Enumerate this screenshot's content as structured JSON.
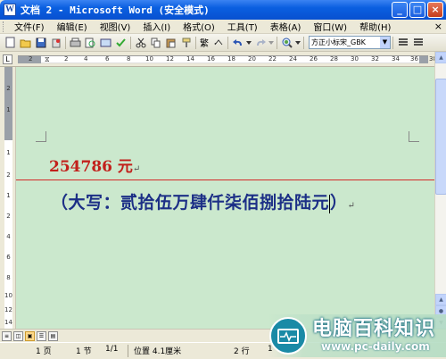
{
  "window": {
    "icon_letter": "W",
    "title": "文档 2 - Microsoft Word (安全模式)",
    "minimize": "_",
    "maximize": "□",
    "close": "×"
  },
  "menu": {
    "items": [
      "文件(F)",
      "编辑(E)",
      "视图(V)",
      "插入(I)",
      "格式(O)",
      "工具(T)",
      "表格(A)",
      "窗口(W)",
      "帮助(H)"
    ],
    "close_doc": "×"
  },
  "toolbar": {
    "trad_char": "繁",
    "font_name": "方正小标宋_GBK"
  },
  "ruler": {
    "corner": "L",
    "numbers": [
      "2",
      "2",
      "4",
      "6",
      "8",
      "10",
      "12",
      "14",
      "16",
      "18",
      "20",
      "22",
      "24",
      "26",
      "28",
      "30",
      "32",
      "34",
      "36",
      "38"
    ],
    "vnumbers": [
      "2",
      "1",
      "1",
      "2",
      "1",
      "2",
      "4",
      "6",
      "8",
      "10",
      "12",
      "14"
    ]
  },
  "document": {
    "amount": "254786 元",
    "capital": "（大写：贰拾伍万肆仟柒佰捌拾陆元",
    "capital_close": "）",
    "para_mark": "↵"
  },
  "status": {
    "page": "1 页",
    "section": "1 节",
    "page_of": "1/1",
    "position": "位置 4.1厘米",
    "line": "2 行",
    "column": "1"
  },
  "watermark": {
    "title": "电脑百科知识",
    "url": "www.pc-daily.com"
  },
  "colors": {
    "amount": "#c2201b",
    "capital": "#1c2f86",
    "page_bg": "#cbe8cd",
    "guide_line": "#d42a2a"
  }
}
